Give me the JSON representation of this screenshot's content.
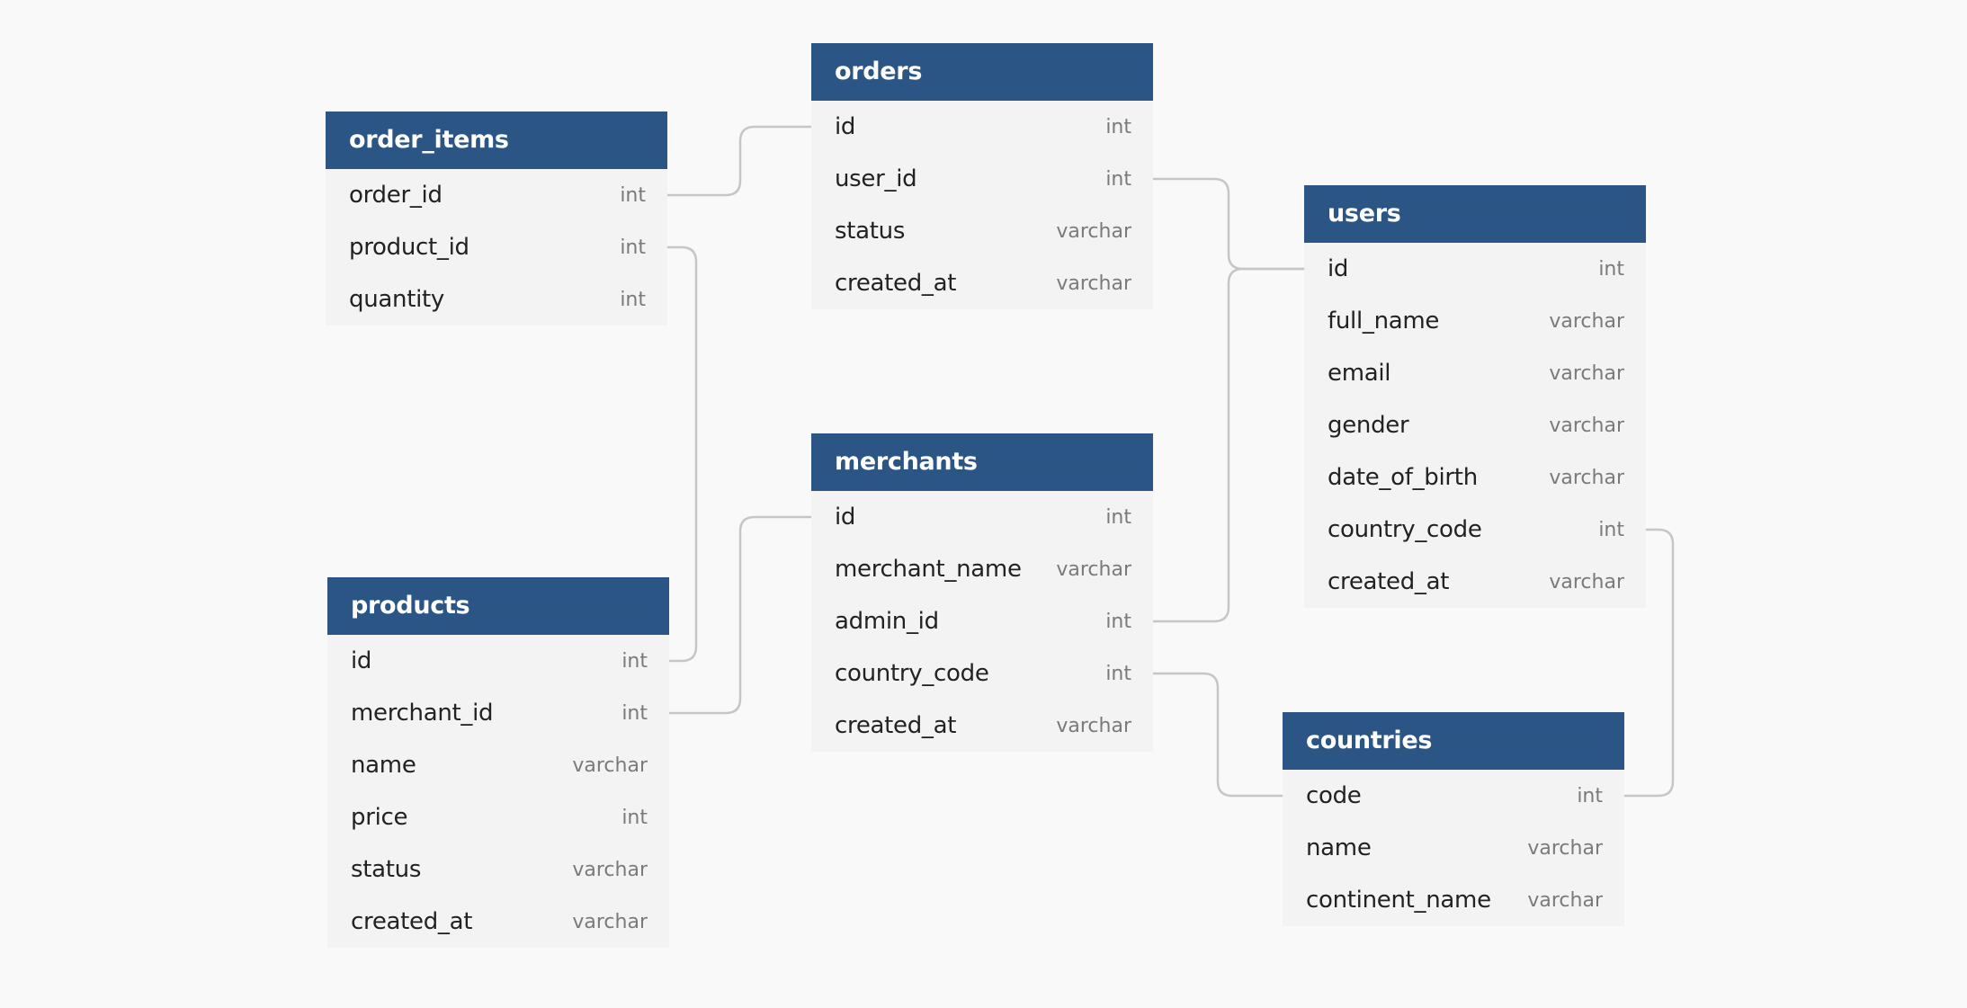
{
  "diagram": {
    "colors": {
      "header": "#2a5585",
      "body": "#f3f3f3",
      "background": "#f9f9f9",
      "connector": "#c6c6c6"
    },
    "tables": {
      "order_items": {
        "name": "order_items",
        "columns": [
          {
            "name": "order_id",
            "type": "int"
          },
          {
            "name": "product_id",
            "type": "int"
          },
          {
            "name": "quantity",
            "type": "int"
          }
        ]
      },
      "orders": {
        "name": "orders",
        "columns": [
          {
            "name": "id",
            "type": "int"
          },
          {
            "name": "user_id",
            "type": "int"
          },
          {
            "name": "status",
            "type": "varchar"
          },
          {
            "name": "created_at",
            "type": "varchar"
          }
        ]
      },
      "users": {
        "name": "users",
        "columns": [
          {
            "name": "id",
            "type": "int"
          },
          {
            "name": "full_name",
            "type": "varchar"
          },
          {
            "name": "email",
            "type": "varchar"
          },
          {
            "name": "gender",
            "type": "varchar"
          },
          {
            "name": "date_of_birth",
            "type": "varchar"
          },
          {
            "name": "country_code",
            "type": "int"
          },
          {
            "name": "created_at",
            "type": "varchar"
          }
        ]
      },
      "merchants": {
        "name": "merchants",
        "columns": [
          {
            "name": "id",
            "type": "int"
          },
          {
            "name": "merchant_name",
            "type": "varchar"
          },
          {
            "name": "admin_id",
            "type": "int"
          },
          {
            "name": "country_code",
            "type": "int"
          },
          {
            "name": "created_at",
            "type": "varchar"
          }
        ]
      },
      "products": {
        "name": "products",
        "columns": [
          {
            "name": "id",
            "type": "int"
          },
          {
            "name": "merchant_id",
            "type": "int"
          },
          {
            "name": "name",
            "type": "varchar"
          },
          {
            "name": "price",
            "type": "int"
          },
          {
            "name": "status",
            "type": "varchar"
          },
          {
            "name": "created_at",
            "type": "varchar"
          }
        ]
      },
      "countries": {
        "name": "countries",
        "columns": [
          {
            "name": "code",
            "type": "int"
          },
          {
            "name": "name",
            "type": "varchar"
          },
          {
            "name": "continent_name",
            "type": "varchar"
          }
        ]
      }
    },
    "relationships": [
      {
        "from": "order_items.order_id",
        "to": "orders.id"
      },
      {
        "from": "order_items.product_id",
        "to": "products.id"
      },
      {
        "from": "orders.user_id",
        "to": "users.id"
      },
      {
        "from": "merchants.admin_id",
        "to": "users.id"
      },
      {
        "from": "products.merchant_id",
        "to": "merchants.id"
      },
      {
        "from": "merchants.country_code",
        "to": "countries.code"
      },
      {
        "from": "users.country_code",
        "to": "countries.code"
      }
    ]
  }
}
